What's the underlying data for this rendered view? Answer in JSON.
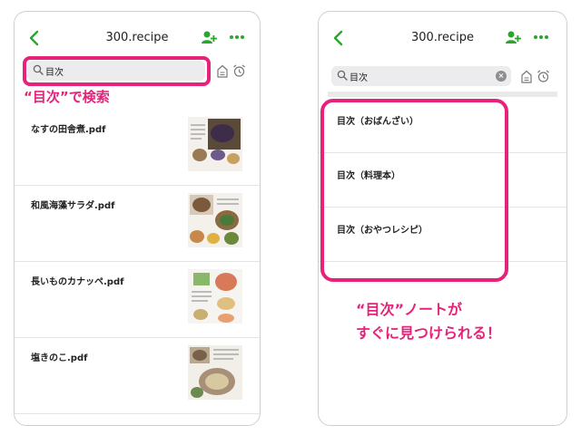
{
  "colors": {
    "accent_green": "#2aa52e",
    "annotation_pink": "#e6237a"
  },
  "left_screen": {
    "title": "300.recipe",
    "icons": [
      "back-chevron-icon",
      "add-user-icon",
      "more-dots-icon",
      "search-icon",
      "tag-icon",
      "alarm-clock-icon"
    ],
    "search": {
      "value": "目次",
      "placeholder": ""
    },
    "annotation": "“目次”で検索",
    "notes": [
      {
        "title": "なすの田舎煮.pdf"
      },
      {
        "title": "和風海藻サラダ.pdf"
      },
      {
        "title": "長いものカナッペ.pdf"
      },
      {
        "title": "塩きのこ.pdf"
      }
    ]
  },
  "right_screen": {
    "title": "300.recipe",
    "icons": [
      "back-chevron-icon",
      "add-user-icon",
      "more-dots-icon",
      "search-icon",
      "clear-icon",
      "tag-icon",
      "alarm-clock-icon"
    ],
    "search": {
      "value": "目次",
      "placeholder": ""
    },
    "results": [
      {
        "title": "目次（おばんざい）"
      },
      {
        "title": "目次（料理本）"
      },
      {
        "title": "目次（おやつレシピ）"
      }
    ],
    "annotation_line1": "“目次”ノートが",
    "annotation_line2": "すぐに見つけられる！"
  }
}
